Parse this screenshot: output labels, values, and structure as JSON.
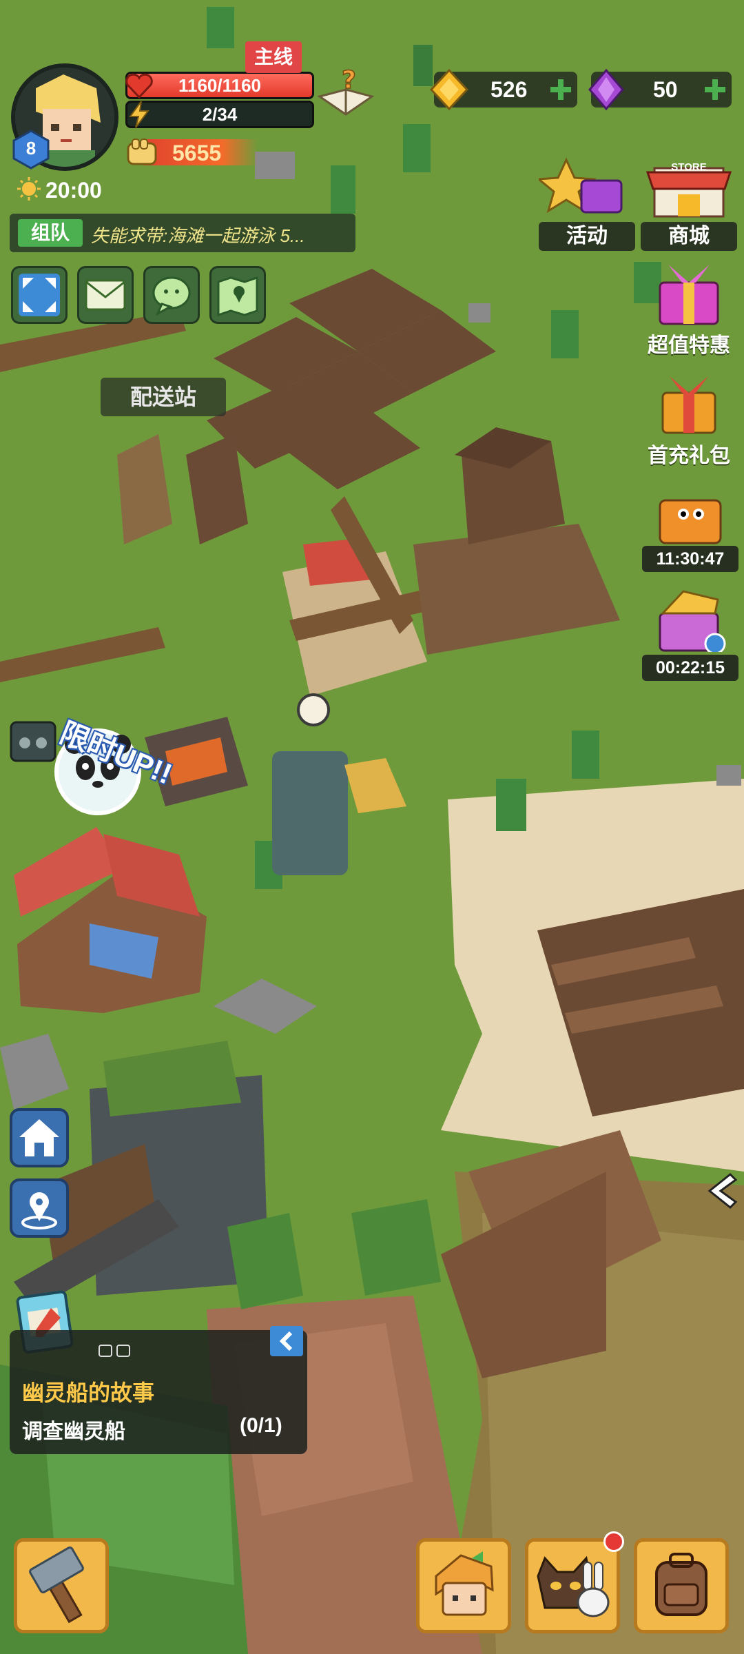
{
  "player": {
    "level": "8",
    "hp": "1160/1160",
    "hp_fraction": 1.0,
    "energy": "2/34",
    "energy_fraction": 0.06,
    "power": "5655",
    "time": "20:00"
  },
  "team": {
    "label": "组队",
    "message": "失能求带:海滩一起游泳 5..."
  },
  "currency": {
    "gold": "526",
    "gems": "50"
  },
  "events": {
    "activity": "活动",
    "store_sign": "STORE",
    "store": "商城",
    "value_deal": "超值特惠",
    "first_recharge": "首充礼包",
    "timer_1": "11:30:47",
    "timer_2": "00:22:15"
  },
  "world": {
    "depot_sign": "配送站",
    "limited_up": "限时UP!!"
  },
  "quest": {
    "title": "幽灵船的故事",
    "tag": "主线",
    "task": "调查幽灵船",
    "progress": "(0/1)"
  },
  "colors": {
    "grass": "#6f9a3b",
    "soil": "#6b4a34",
    "hp_red": "#e23a2c",
    "quest_gold": "#ffc94a",
    "button_gold": "#f2b94a",
    "nav_blue": "#3a6fb0"
  },
  "icons": {
    "quick_buttons": [
      "fullscreen-icon",
      "mail-icon",
      "chat-icon",
      "map-icon"
    ],
    "left_nav": [
      "home-icon",
      "location-pin-icon"
    ],
    "bottom_buttons": [
      "build-hammer-icon",
      "character-portrait-icon",
      "pets-icon",
      "backpack-icon"
    ]
  }
}
